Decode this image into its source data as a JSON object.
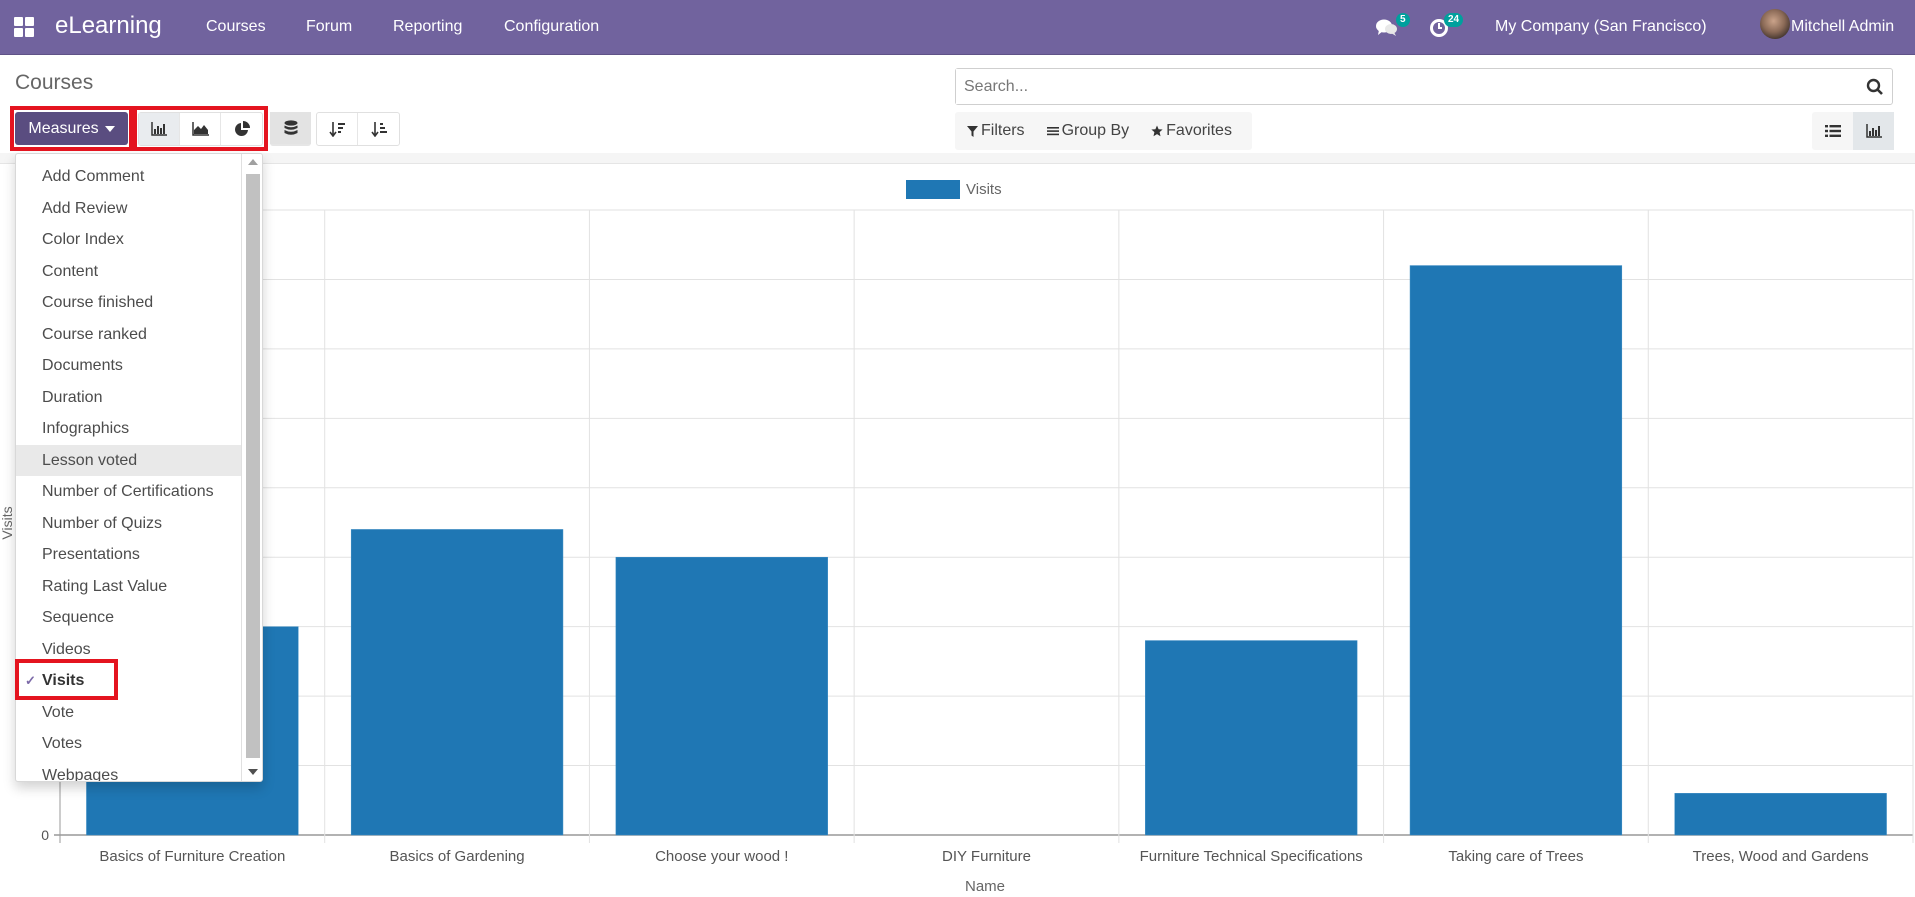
{
  "navbar": {
    "app_name": "eLearning",
    "menus": [
      "Courses",
      "Forum",
      "Reporting",
      "Configuration"
    ],
    "messages_count": "5",
    "activities_count": "24",
    "company": "My Company (San Francisco)",
    "user": "Mitchell Admin"
  },
  "control_panel": {
    "title": "Courses",
    "measures_label": "Measures",
    "search_placeholder": "Search...",
    "filters_label": "Filters",
    "groupby_label": "Group By",
    "favorites_label": "Favorites",
    "chart_types": [
      "bar-chart",
      "line-chart",
      "pie-chart"
    ],
    "active_chart_type": "bar-chart",
    "active_view": "graph"
  },
  "measures_dropdown": {
    "items": [
      {
        "label": "Add Comment",
        "checked": false
      },
      {
        "label": "Add Review",
        "checked": false
      },
      {
        "label": "Color Index",
        "checked": false
      },
      {
        "label": "Content",
        "checked": false
      },
      {
        "label": "Course finished",
        "checked": false
      },
      {
        "label": "Course ranked",
        "checked": false
      },
      {
        "label": "Documents",
        "checked": false
      },
      {
        "label": "Duration",
        "checked": false
      },
      {
        "label": "Infographics",
        "checked": false
      },
      {
        "label": "Lesson voted",
        "checked": false,
        "hover": true
      },
      {
        "label": "Number of Certifications",
        "checked": false
      },
      {
        "label": "Number of Quizs",
        "checked": false
      },
      {
        "label": "Presentations",
        "checked": false
      },
      {
        "label": "Rating Last Value",
        "checked": false
      },
      {
        "label": "Sequence",
        "checked": false
      },
      {
        "label": "Videos",
        "checked": false
      },
      {
        "label": "Visits",
        "checked": true
      },
      {
        "label": "Vote",
        "checked": false
      },
      {
        "label": "Votes",
        "checked": false
      },
      {
        "label": "Webpages",
        "checked": false
      }
    ],
    "check_glyph": "✓"
  },
  "chart_data": {
    "type": "bar",
    "title": "",
    "legend": [
      "Visits"
    ],
    "legend_position": "top-center",
    "xlabel": "Name",
    "ylabel": "Visits",
    "categories": [
      "Basics of Furniture Creation",
      "Basics of Gardening",
      "Choose your wood !",
      "DIY Furniture",
      "Furniture Technical Specifications",
      "Taking care of Trees",
      "Trees, Wood and Gardens"
    ],
    "series": [
      {
        "name": "Visits",
        "values": [
          3.0,
          4.4,
          4.0,
          0,
          2.8,
          8.2,
          0.6
        ],
        "color": "#1f77b4"
      }
    ],
    "ylim": [
      0,
      9
    ],
    "ytick_step": 1,
    "visible_ytick_labels": [
      "0"
    ],
    "grid": true
  }
}
